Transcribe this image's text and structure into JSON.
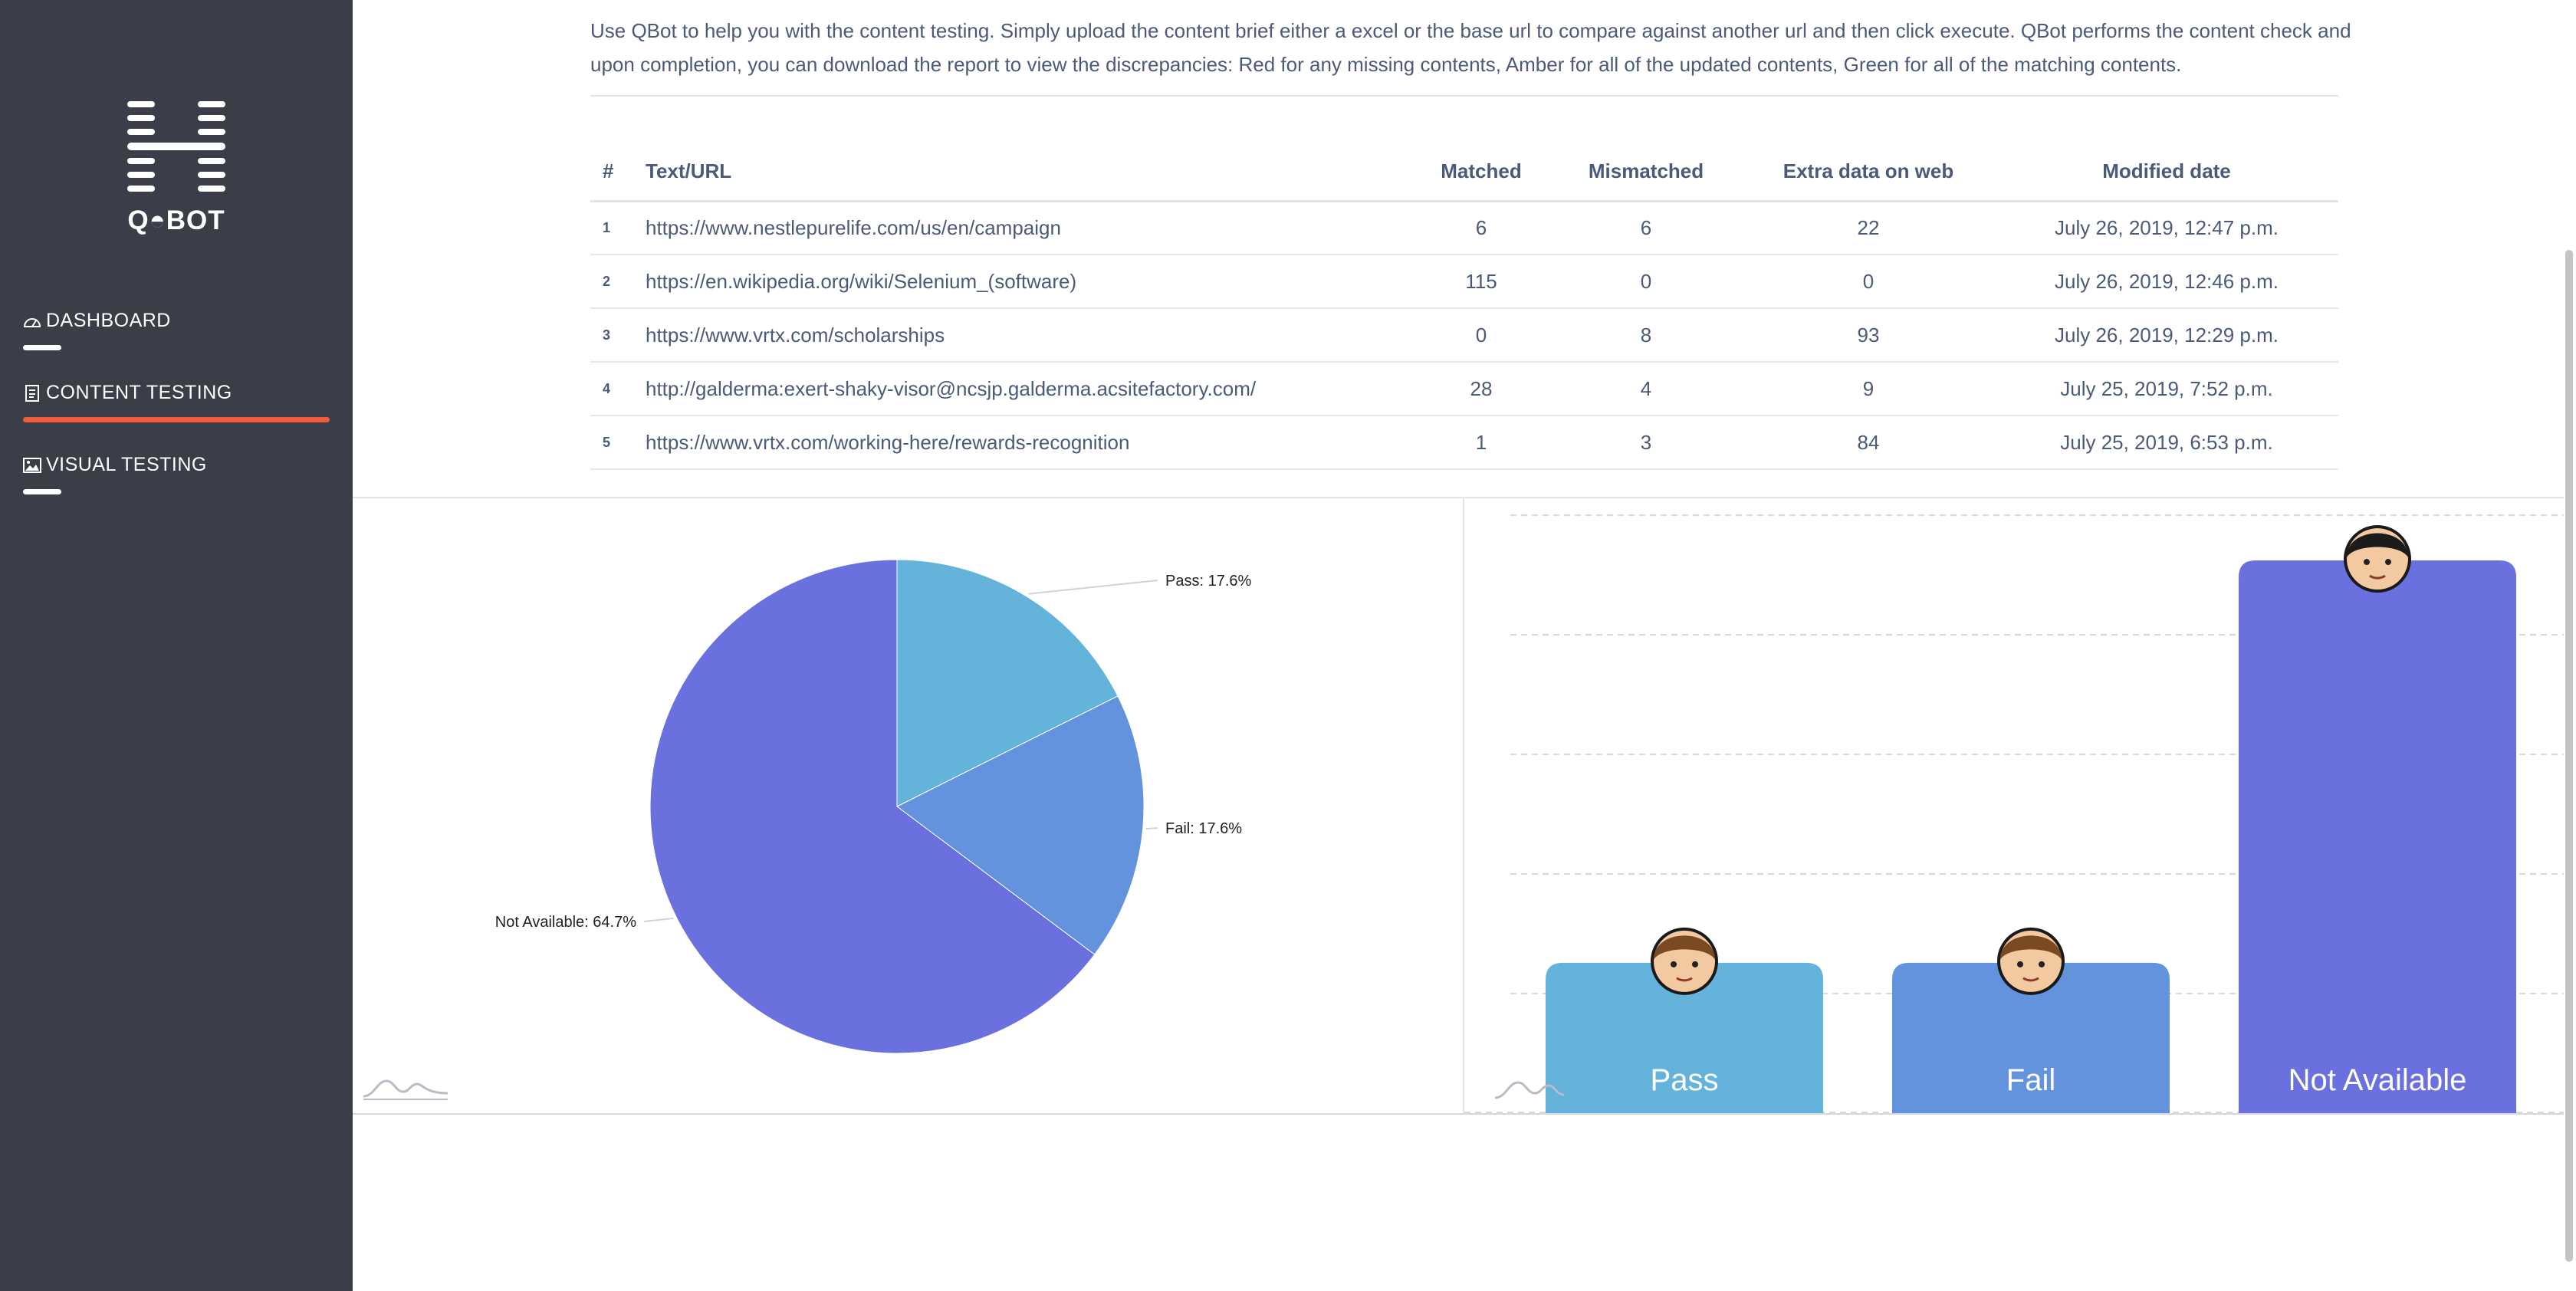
{
  "brand": {
    "logo_text": "Q◓BOT"
  },
  "sidebar": {
    "items": [
      {
        "label": "DASHBOARD",
        "icon": "gauge-icon",
        "active": false
      },
      {
        "label": "CONTENT TESTING",
        "icon": "document-icon",
        "active": true
      },
      {
        "label": "VISUAL TESTING",
        "icon": "image-icon",
        "active": false
      }
    ],
    "accent_color": "#f25b3b"
  },
  "main": {
    "description": "Use QBot to help you with the content testing. Simply upload the content brief either a excel or the base url to compare against another url and then click execute. QBot performs the content check and upon completion, you can download the report to view the discrepancies: Red for any missing contents, Amber for all of the updated contents, Green for all of the matching contents."
  },
  "table": {
    "headers": [
      "#",
      "Text/URL",
      "Matched",
      "Mismatched",
      "Extra data on web",
      "Modified date"
    ],
    "rows": [
      [
        "1",
        "https://www.nestlepurelife.com/us/en/campaign",
        "6",
        "6",
        "22",
        "July 26, 2019, 12:47 p.m."
      ],
      [
        "2",
        "https://en.wikipedia.org/wiki/Selenium_(software)",
        "115",
        "0",
        "0",
        "July 26, 2019, 12:46 p.m."
      ],
      [
        "3",
        "https://www.vrtx.com/scholarships",
        "0",
        "8",
        "93",
        "July 26, 2019, 12:29 p.m."
      ],
      [
        "4",
        "http://galderma:exert-shaky-visor@ncsjp.galderma.acsitefactory.com/",
        "28",
        "4",
        "9",
        "July 25, 2019, 7:52 p.m."
      ],
      [
        "5",
        "https://www.vrtx.com/working-here/rewards-recognition",
        "1",
        "3",
        "84",
        "July 25, 2019, 6:53 p.m."
      ]
    ]
  },
  "chart_data": [
    {
      "type": "pie",
      "categories": [
        "Pass",
        "Fail",
        "Not Available"
      ],
      "values": [
        17.6,
        17.6,
        64.7
      ],
      "labels": [
        "Pass: 17.6%",
        "Fail: 17.6%",
        "Not Available: 64.7%"
      ],
      "colors": [
        "#63b3da",
        "#6393dc",
        "#6a70de"
      ]
    },
    {
      "type": "bar",
      "categories": [
        "Pass",
        "Fail",
        "Not Available"
      ],
      "values": [
        17.6,
        17.6,
        64.7
      ],
      "colors": [
        "#63b3da",
        "#6393dc",
        "#6a70de"
      ],
      "markers": [
        "avatar-boy-icon",
        "avatar-man-icon",
        "avatar-girl-icon"
      ],
      "grid": true
    }
  ]
}
